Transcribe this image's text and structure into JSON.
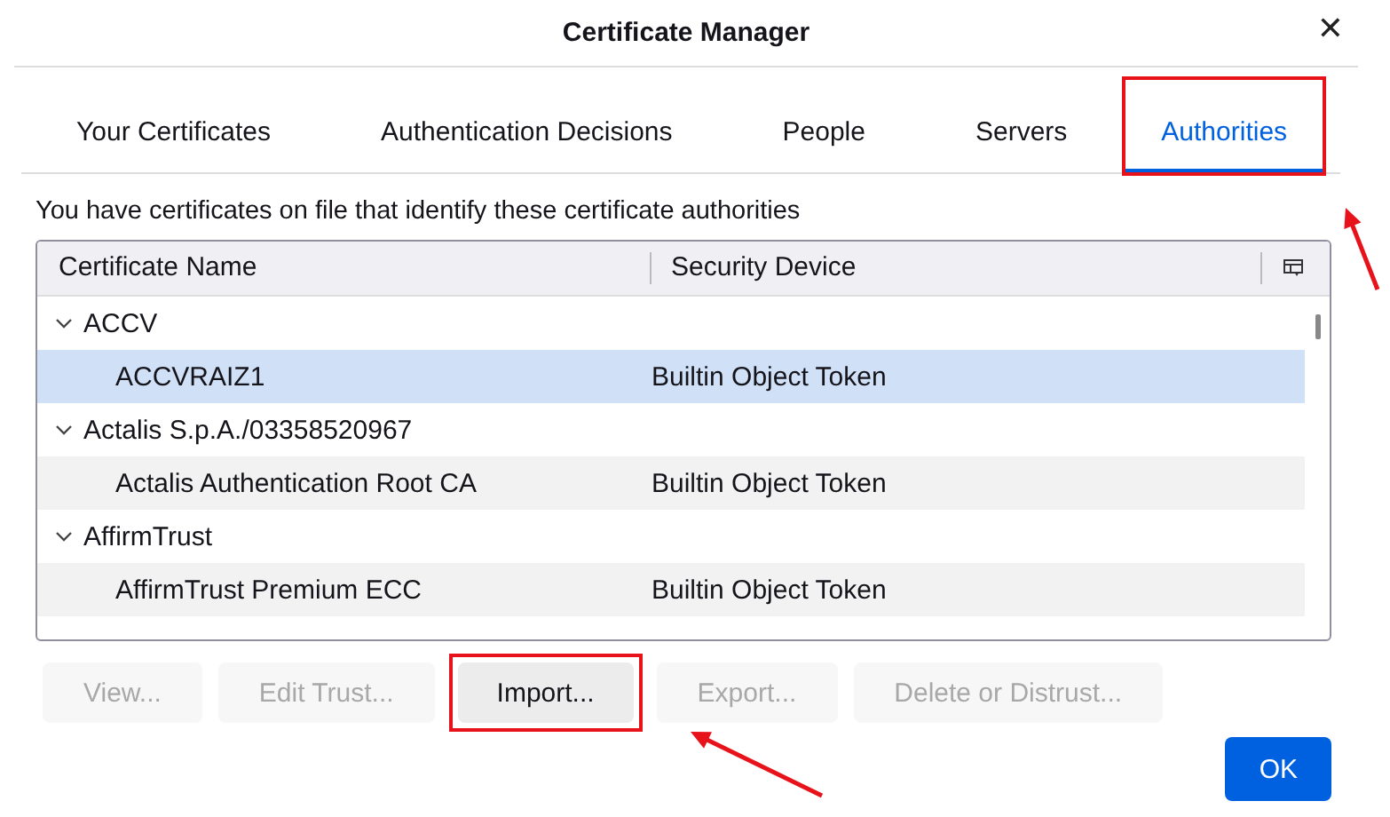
{
  "window": {
    "title": "Certificate Manager",
    "close": "✕"
  },
  "tabs": [
    {
      "label": "Your Certificates",
      "selected": false,
      "highlighted": false
    },
    {
      "label": "Authentication Decisions",
      "selected": false,
      "highlighted": false
    },
    {
      "label": "People",
      "selected": false,
      "highlighted": false
    },
    {
      "label": "Servers",
      "selected": false,
      "highlighted": false
    },
    {
      "label": "Authorities",
      "selected": true,
      "highlighted": true
    }
  ],
  "description": "You have certificates on file that identify these certificate authorities",
  "table": {
    "columns": [
      "Certificate Name",
      "Security Device"
    ],
    "rows": [
      {
        "name": "ACCV",
        "expanded": true,
        "selected": false,
        "children": [
          {
            "name": "ACCVRAIZ1",
            "device": "Builtin Object Token",
            "selected": true
          }
        ]
      },
      {
        "name": "Actalis S.p.A./03358520967",
        "expanded": true,
        "selected": false,
        "children": [
          {
            "name": "Actalis Authentication Root CA",
            "device": "Builtin Object Token",
            "selected": false
          }
        ]
      },
      {
        "name": "AffirmTrust",
        "expanded": true,
        "selected": false,
        "children": [
          {
            "name": "AffirmTrust Premium ECC",
            "device": "Builtin Object Token",
            "selected": false
          }
        ]
      }
    ]
  },
  "buttons": [
    {
      "label": "View...",
      "disabled": true,
      "highlighted": false
    },
    {
      "label": "Edit Trust...",
      "disabled": true,
      "highlighted": false
    },
    {
      "label": "Import...",
      "disabled": false,
      "highlighted": true
    },
    {
      "label": "Export...",
      "disabled": true,
      "highlighted": false
    },
    {
      "label": "Delete or Distrust...",
      "disabled": true,
      "highlighted": false
    }
  ],
  "ok_button": "OK"
}
